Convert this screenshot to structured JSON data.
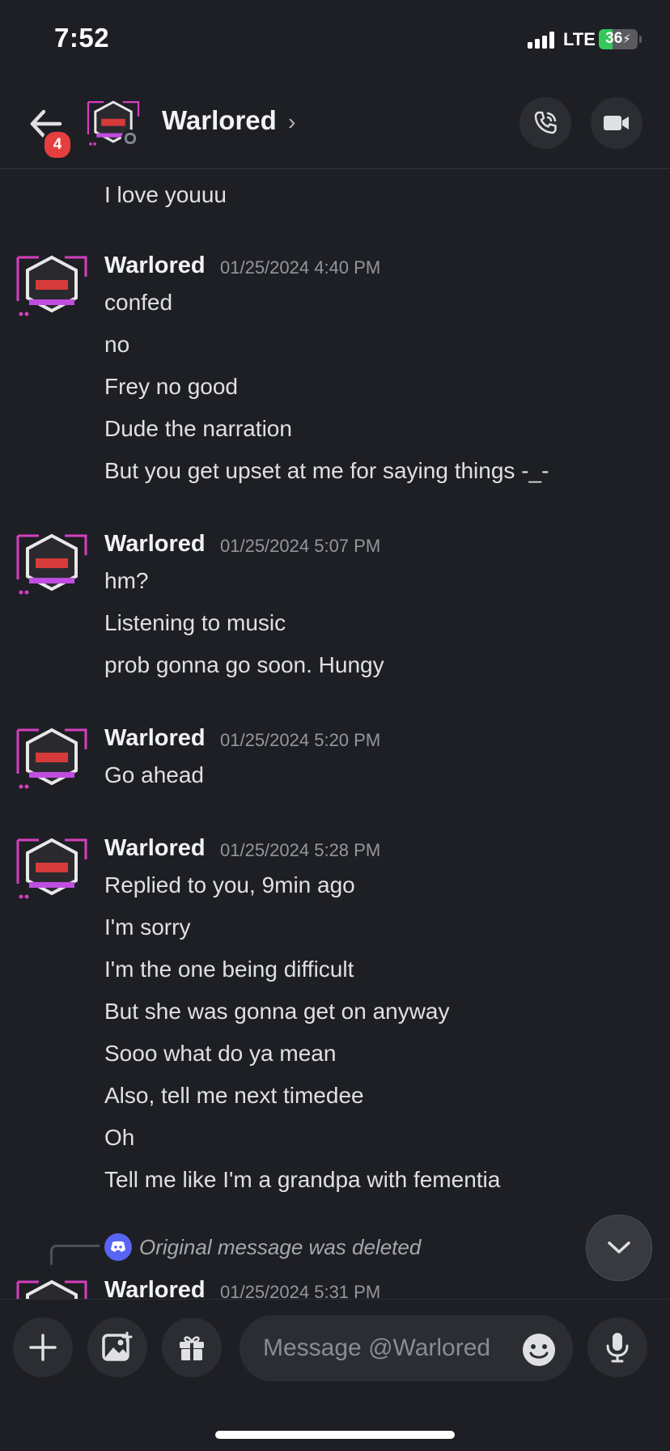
{
  "status_bar": {
    "time": "7:52",
    "network": "LTE",
    "battery": "36",
    "battery_level": 0.36
  },
  "header": {
    "unread_badge": "4",
    "name": "Warlored",
    "chevron": "›"
  },
  "messages": {
    "first_line": "I love youuu",
    "groups": [
      {
        "author": "Warlored",
        "timestamp": "01/25/2024 4:40 PM",
        "lines": [
          "confed",
          "no",
          "Frey no good",
          "Dude the narration",
          "But you get upset at me for saying things -_-"
        ]
      },
      {
        "author": "Warlored",
        "timestamp": "01/25/2024 5:07 PM",
        "lines": [
          "hm?",
          "Listening to music",
          "prob gonna go soon. Hungy"
        ]
      },
      {
        "author": "Warlored",
        "timestamp": "01/25/2024 5:20 PM",
        "lines": [
          "Go ahead"
        ]
      },
      {
        "author": "Warlored",
        "timestamp": "01/25/2024 5:28 PM",
        "lines": [
          "Replied to you, 9min ago",
          "I'm sorry",
          "I'm the one being difficult",
          "But she was gonna get on anyway",
          "Sooo what do ya mean",
          "Also, tell me next timedee",
          "Oh",
          "Tell me like I'm a grandpa with fementia"
        ]
      }
    ],
    "reply": {
      "text": "Original message was deleted"
    },
    "last_group": {
      "author": "Warlored",
      "timestamp": "01/25/2024 5:31 PM"
    }
  },
  "composer": {
    "placeholder": "Message @Warlored"
  },
  "colors": {
    "background": "#1e1f24",
    "surface": "#2b2d33",
    "badge": "#e53e3e",
    "blurple": "#5865f2",
    "battery": "#34c759"
  }
}
